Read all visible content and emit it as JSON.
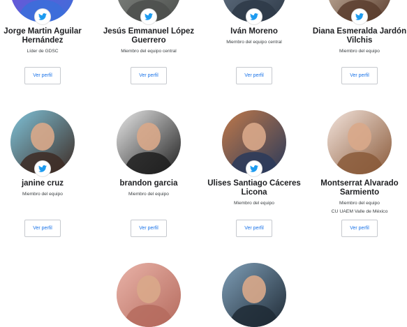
{
  "members": [
    {
      "name": "Jorge Martin Aguilar Hernández",
      "role": "Líder de GDSC",
      "affiliation": "",
      "button": "Ver perfil",
      "twitter": true,
      "icon": "twitter-icon",
      "avatar_colors": [
        "#7b4ed8",
        "#3b6fd9"
      ]
    },
    {
      "name": "Jesús Emmanuel López Guerrero",
      "role": "Miembro del equipo central",
      "affiliation": "",
      "button": "Ver perfil",
      "twitter": true,
      "icon": "twitter-icon",
      "avatar_colors": [
        "#8b8e8a",
        "#4c4f4c"
      ]
    },
    {
      "name": "Iván Moreno",
      "role": "Miembro del equipo central",
      "affiliation": "",
      "button": "Ver perfil",
      "twitter": true,
      "icon": "twitter-icon",
      "avatar_colors": [
        "#6b7a8c",
        "#2e3a48"
      ]
    },
    {
      "name": "Diana Esmeralda Jardón Vilchis",
      "role": "Miembro del equipo",
      "affiliation": "",
      "button": "Ver perfil",
      "twitter": true,
      "icon": "twitter-icon",
      "avatar_colors": [
        "#d9c7b4",
        "#5a3d2e"
      ]
    },
    {
      "name": "janine cruz",
      "role": "Miembro del equipo",
      "affiliation": "",
      "button": "Ver perfil",
      "twitter": true,
      "icon": "twitter-icon",
      "avatar_colors": [
        "#7fc3d9",
        "#3d2b24"
      ]
    },
    {
      "name": "brandon garcia",
      "role": "Miembro del equipo",
      "affiliation": "",
      "button": "Ver perfil",
      "twitter": false,
      "icon": "",
      "avatar_colors": [
        "#e8e8e8",
        "#1e1e1e"
      ]
    },
    {
      "name": "Ulises Santiago Cáceres Licona",
      "role": "Miembro del equipo",
      "affiliation": "",
      "button": "Ver perfil",
      "twitter": true,
      "icon": "twitter-icon",
      "avatar_colors": [
        "#c0794a",
        "#2a3a5a"
      ]
    },
    {
      "name": "Montserrat Alvarado Sarmiento",
      "role": "Miembro del equipo",
      "affiliation": "CU UAEM Valle de México",
      "button": "Ver perfil",
      "twitter": false,
      "icon": "",
      "avatar_colors": [
        "#f3e4dc",
        "#8a5a3a"
      ]
    },
    {
      "name": "",
      "role": "",
      "affiliation": "",
      "button": "",
      "twitter": false,
      "icon": "",
      "avatar_colors": [
        "#e9b3a8",
        "#b56b5e"
      ]
    },
    {
      "name": "",
      "role": "",
      "affiliation": "",
      "button": "",
      "twitter": false,
      "icon": "",
      "avatar_colors": [
        "#7f9fb8",
        "#1f2a35"
      ]
    }
  ],
  "colors": {
    "twitter": "#1d9bf0",
    "link": "#1a73e8",
    "border": "#c6c9ce"
  }
}
